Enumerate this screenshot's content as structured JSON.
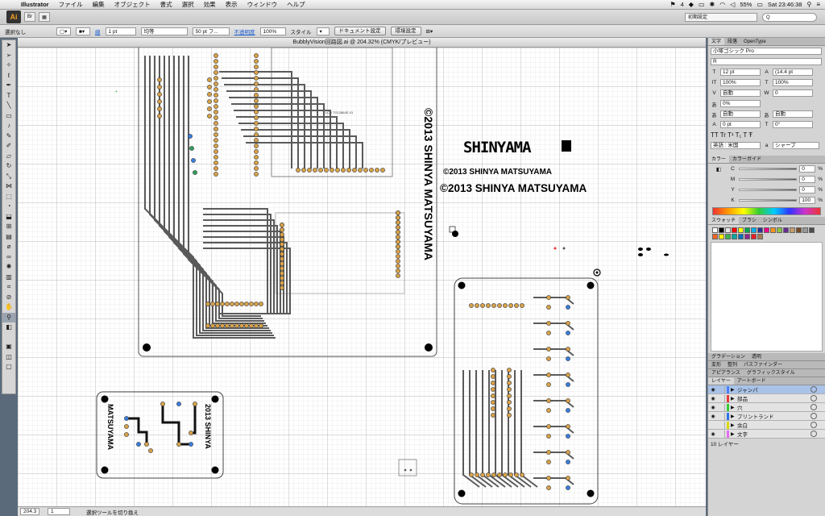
{
  "menubar": {
    "app_name": "Illustrator",
    "items": [
      "ファイル",
      "編集",
      "オブジェクト",
      "書式",
      "選択",
      "効果",
      "表示",
      "ウィンドウ",
      "ヘルプ"
    ],
    "status_badge": "4",
    "battery": "55%",
    "clock": "Sat 23:46:38"
  },
  "appbar": {
    "logo": "Ai",
    "workspace": "初期設定",
    "search_placeholder": "Q"
  },
  "controlbar": {
    "selection": "選択なし",
    "stroke_label": "線",
    "stroke_weight": "1 pt",
    "stroke_profile": "均等",
    "brush": "50 pt フ...",
    "opacity_label": "不透明度",
    "opacity": "100%",
    "style_label": "スタイル",
    "doc_settings": "ドキュメント設定",
    "prefs": "環境設定"
  },
  "document": {
    "title": "BubblyVision回路図.ai @ 204.32% (CMYK/プレビュー)"
  },
  "artwork": {
    "logo": "SHINYAMA",
    "copyright_small": "©2013 SHINYA MATSUYAMA",
    "copyright_large": "©2013 SHINYA MATSUYAMA",
    "rotated_text": "©2013 SHINYA MATSUYAMA",
    "lcd_label": "LCD TG12864E-01",
    "small_board_left": "MATSUYAMA",
    "small_board_right": "2013 SHINYA"
  },
  "statusbar": {
    "zoom": "204.3",
    "page": "1",
    "tool_hint": "選択ツールを切り換え"
  },
  "character_panel": {
    "tabs": [
      "文字",
      "段落",
      "OpenType"
    ],
    "font_family": "小塚ゴシック Pro",
    "font_style": "R",
    "font_size": "12 pt",
    "leading": "(14.4 pt",
    "vscale": "100%",
    "hscale": "100%",
    "kerning": "自動",
    "tracking": "0",
    "tsume": "0%",
    "aki_left": "自動",
    "aki_right": "自動",
    "baseline": "0 pt",
    "rotation": "0°",
    "language": "英語 : 米国",
    "antialias": "シャープ"
  },
  "color_panel": {
    "tabs": [
      "カラー",
      "カラーガイド"
    ],
    "channels": [
      {
        "label": "C",
        "value": "0"
      },
      {
        "label": "M",
        "value": "0"
      },
      {
        "label": "Y",
        "value": "0"
      },
      {
        "label": "K",
        "value": "100"
      }
    ],
    "unit": "%"
  },
  "swatch_panel": {
    "tabs": [
      "スウォッチ",
      "ブラシ",
      "シンボル"
    ],
    "colors": [
      "#ffffff",
      "#000000",
      "#e8e8e8",
      "#ff0000",
      "#ffff00",
      "#00a651",
      "#00aeef",
      "#2e3192",
      "#ec008c",
      "#f7941d",
      "#8dc63f",
      "#662d91",
      "#c69c6d",
      "#754c24",
      "#999999",
      "#4d4d4d",
      "#f26522",
      "#fff200",
      "#39b54a",
      "#00a99d",
      "#0072bc",
      "#92278f",
      "#ed1c24",
      "#a67c52"
    ]
  },
  "small_panels": {
    "gradient_tabs": [
      "グラデーション",
      "透明"
    ],
    "transform_tabs": [
      "変形",
      "整列",
      "パスファインダー"
    ],
    "appearance_tabs": [
      "アピアランス",
      "グラフィックスタイル"
    ],
    "layer_tabs": [
      "レイヤー",
      "アートボード"
    ]
  },
  "layers": {
    "items": [
      {
        "name": "ジャンパ",
        "color": "#4d7fff",
        "visible": true,
        "selected": true
      },
      {
        "name": "部品",
        "color": "#e23b3b",
        "visible": true,
        "selected": false
      },
      {
        "name": "穴",
        "color": "#33cc33",
        "visible": true,
        "selected": false
      },
      {
        "name": "プリントランド",
        "color": "#2a6fe8",
        "visible": true,
        "selected": false
      },
      {
        "name": "余白",
        "color": "#d9d900",
        "visible": false,
        "selected": false
      },
      {
        "name": "文字",
        "color": "#e36df0",
        "visible": true,
        "selected": false
      }
    ],
    "count_label": "10 レイヤー"
  },
  "colors": {
    "accent": "#1e5fd0",
    "trace": "#5a5a5a",
    "pad": "#d8a24a"
  }
}
